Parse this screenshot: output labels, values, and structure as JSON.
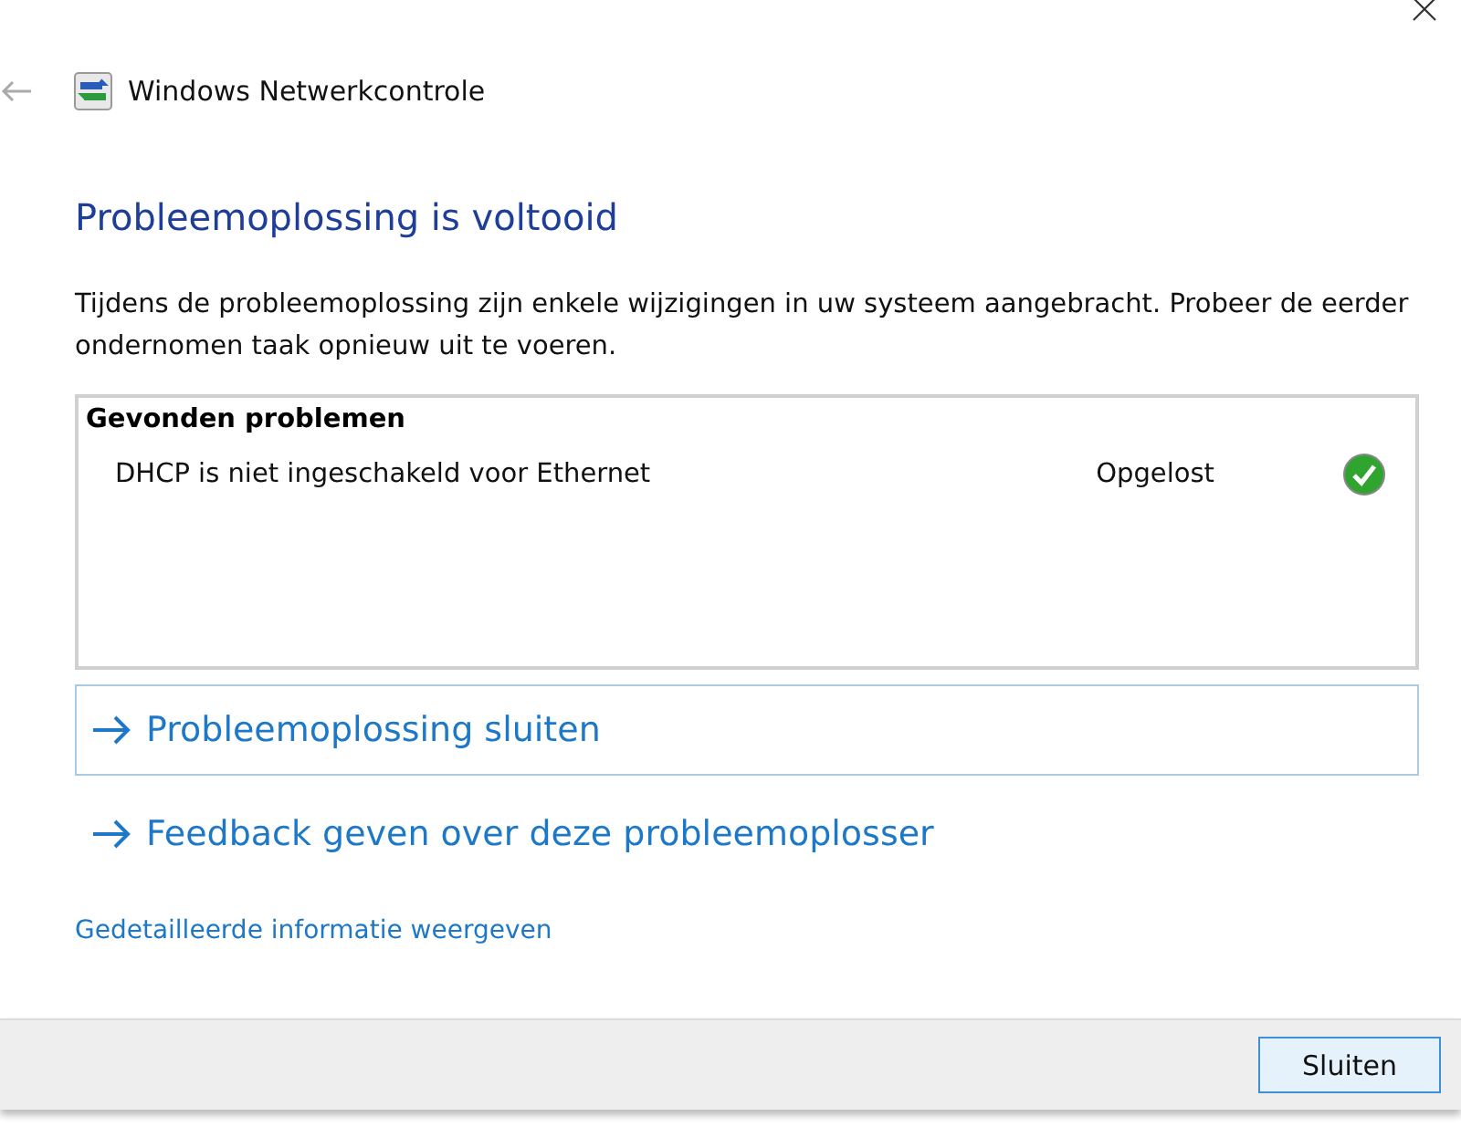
{
  "window": {
    "title": "Windows Netwerkcontrole"
  },
  "heading": "Probleemoplossing is voltooid",
  "description": "Tijdens de probleemoplossing zijn enkele wijzigingen in uw systeem aangebracht. Probeer de eerder ondernomen taak opnieuw uit te voeren.",
  "problems": {
    "title": "Gevonden problemen",
    "rows": [
      {
        "name": "DHCP is niet ingeschakeld voor Ethernet",
        "status": "Opgelost"
      }
    ]
  },
  "actions": [
    {
      "label": "Probleemoplossing sluiten",
      "selected": true
    },
    {
      "label": "Feedback geven over deze probleemoplosser",
      "selected": false
    }
  ],
  "details_link": "Gedetailleerde informatie weergeven",
  "buttons": [
    "Sluiten"
  ]
}
